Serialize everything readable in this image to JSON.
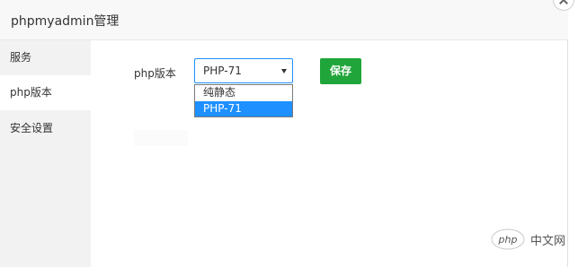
{
  "dialog": {
    "title": "phpmyadmin管理"
  },
  "sidebar": {
    "items": [
      {
        "label": "服务"
      },
      {
        "label": "php版本"
      },
      {
        "label": "安全设置"
      }
    ],
    "active": "php版本"
  },
  "form": {
    "php_version_label": "php版本",
    "select_value": "PHP-71",
    "options": [
      "纯静态",
      "PHP-71"
    ],
    "selected_option": "PHP-71",
    "save_label": "保存"
  },
  "watermark": {
    "logo_text": "php",
    "site_text": "中文网"
  },
  "colors": {
    "accent": "#1e90ff",
    "save_button": "#20a53a",
    "sidebar_bg": "#f2f2f2",
    "titlebar_bg": "#f8f8f8"
  }
}
